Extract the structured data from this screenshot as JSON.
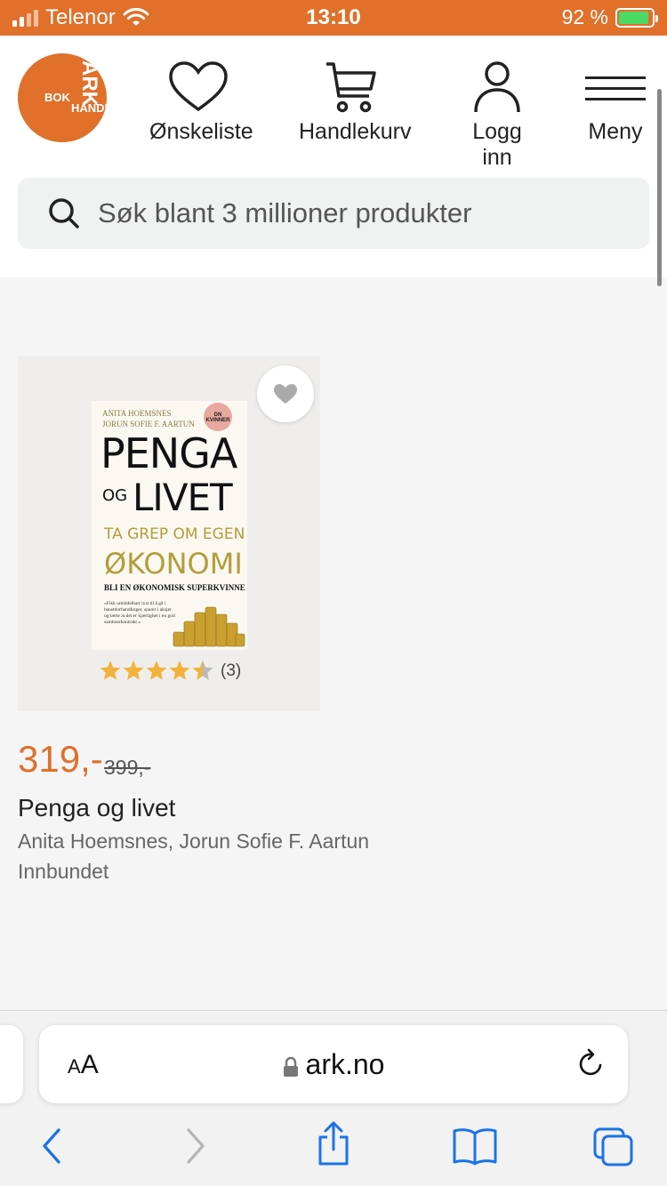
{
  "status_bar": {
    "carrier": "Telenor",
    "time": "13:10",
    "battery": "92 %",
    "battery_level": 0.92
  },
  "header": {
    "logo": {
      "word": "ARK",
      "line1": "BOK",
      "line2": "HANDEL"
    },
    "nav": {
      "wishlist": "Ønskeliste",
      "cart": "Handlekurv",
      "login": "Logg inn",
      "menu": "Meny"
    },
    "search_placeholder": "Søk blant 3 millioner produkter"
  },
  "product": {
    "cover": {
      "authors_line1": "ANITA HOEMSNES",
      "authors_line2": "JORUN SOFIE F. AARTUN",
      "badge": "DN KVINNER",
      "title_word1": "PENGA",
      "title_og": "OG",
      "title_word2": "LIVET",
      "subtitle1": "TA GREP OM EGEN",
      "subtitle2": "ØKONOMI",
      "tagline": "BLI EN ØKONOMISK SUPERKVINNE",
      "quote": "«Fikk umiddelbart lyst til å gå i banstdorhandlinger, sparer i aksjer og lærte at det er kjærlighet i en god samboerkontrakt.»"
    },
    "rating": 4.5,
    "rating_count": "(3)",
    "price": "319,-",
    "old_price": "399,-",
    "title": "Penga og livet",
    "authors": "Anita Hoemsnes, Jorun Sofie F. Aartun",
    "format": "Innbundet"
  },
  "browser": {
    "text_size_label": "AA",
    "url": "ark.no"
  },
  "colors": {
    "brand": "#e0702a",
    "star": "#f2b33d",
    "ios_blue": "#1a73e8"
  }
}
